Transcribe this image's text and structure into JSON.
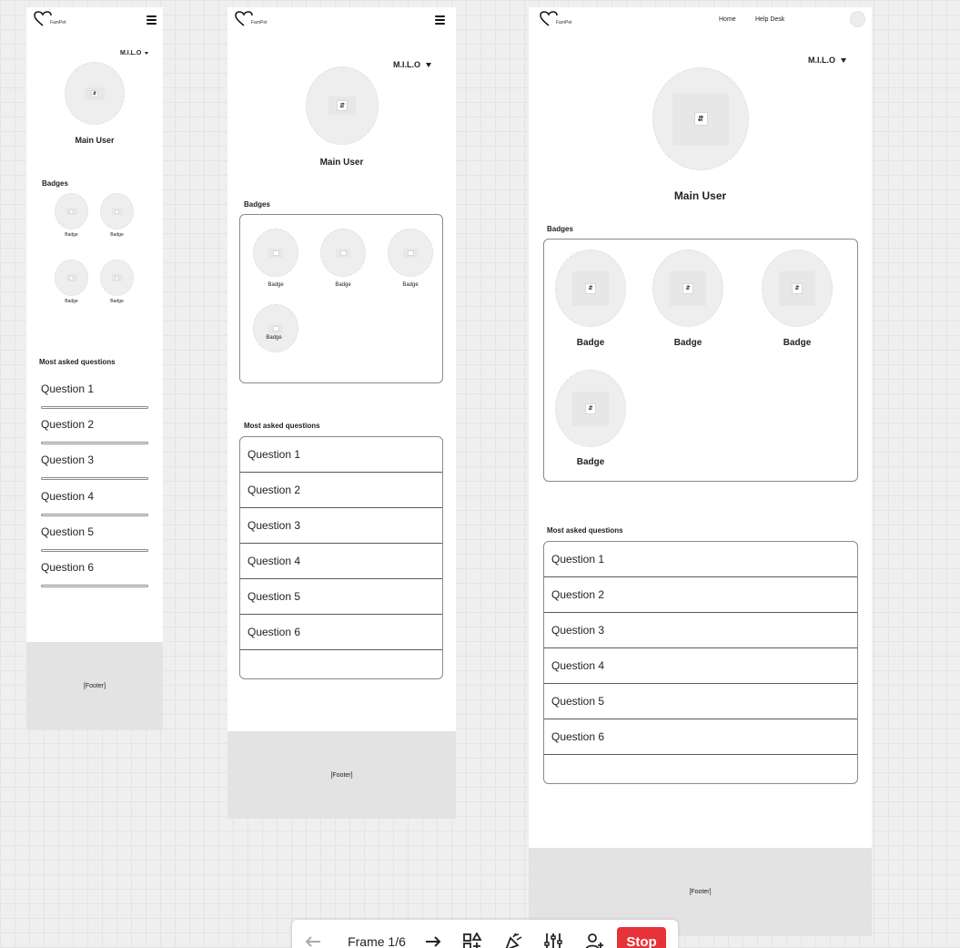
{
  "logo": {
    "text": "FamPet"
  },
  "header": {
    "nav": [
      "Home",
      "Help Desk"
    ]
  },
  "profile": {
    "dropdown_label": "M.I.L.O",
    "user_name": "Main User"
  },
  "badges": {
    "title": "Badges",
    "items": [
      "Badge",
      "Badge",
      "Badge",
      "Badge"
    ]
  },
  "faq": {
    "title": "Most asked questions",
    "questions": [
      "Question 1",
      "Question 2",
      "Question 3",
      "Question 4",
      "Question 5",
      "Question 6"
    ]
  },
  "footer": {
    "label": "[Footer]"
  },
  "toolbar": {
    "frame_label": "Frame 1/6",
    "stop_label": "Stop",
    "stop_color": "#e8323a",
    "icons": [
      "arrow-left-icon",
      "arrow-right-icon",
      "shapes-add-icon",
      "party-popper-icon",
      "sliders-icon",
      "add-person-icon"
    ]
  },
  "colors": {
    "canvas": "#efefef",
    "frame": "#ffffff",
    "footer": "#e3e3e3",
    "accent": "#e8323a"
  }
}
